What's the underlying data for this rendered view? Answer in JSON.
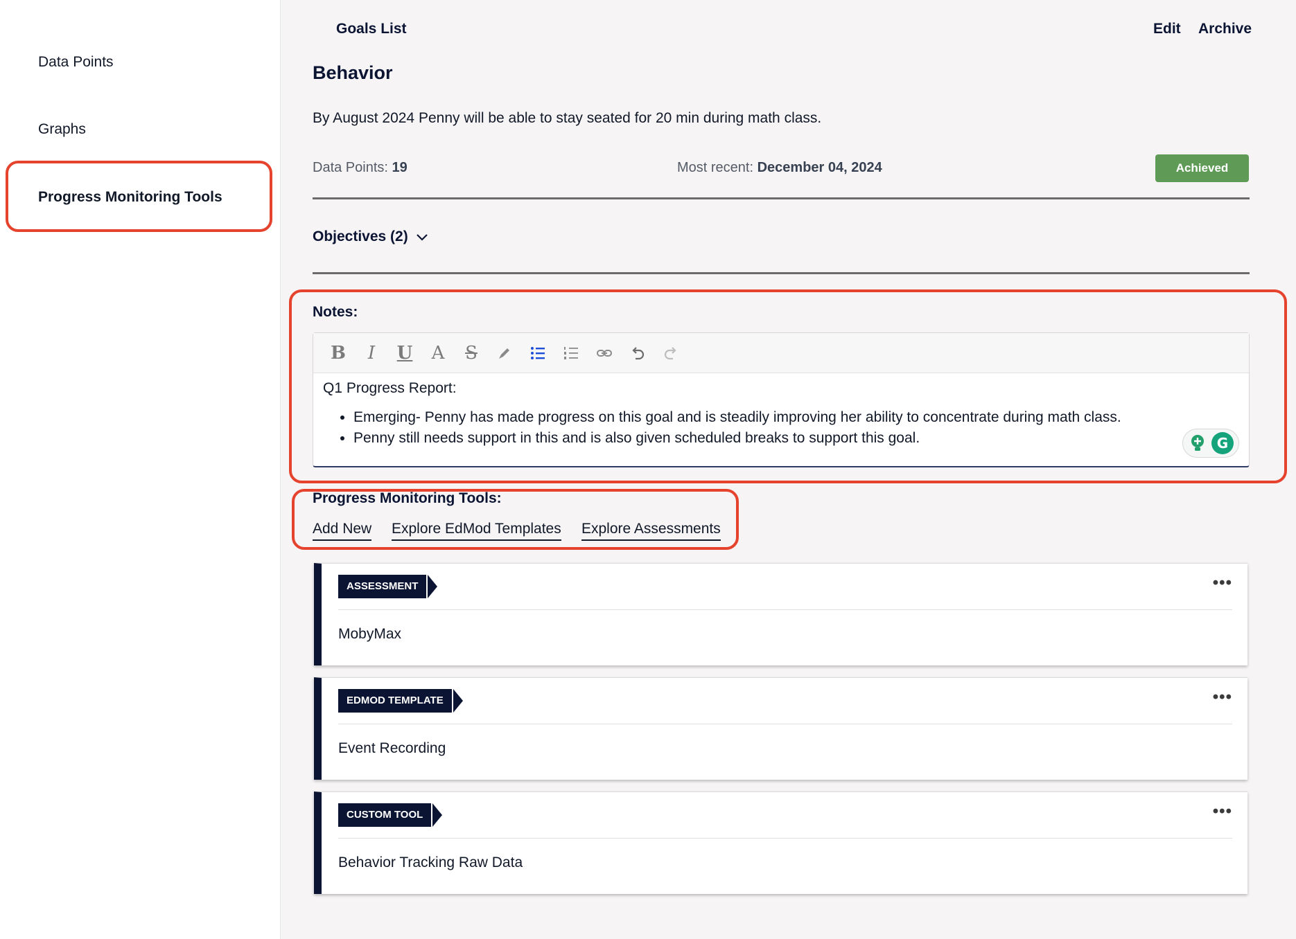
{
  "sidebar": {
    "items": [
      {
        "label": "Data Points"
      },
      {
        "label": "Graphs"
      },
      {
        "label": "Progress Monitoring Tools"
      }
    ]
  },
  "header": {
    "goals_list": "Goals List",
    "edit": "Edit",
    "archive": "Archive"
  },
  "goal": {
    "title": "Behavior",
    "description": "By August 2024 Penny will be able to stay seated for 20 min during math class.",
    "data_points_label": "Data Points:",
    "data_points_value": "19",
    "most_recent_label": "Most recent:",
    "most_recent_value": "December 04, 2024",
    "status": "Achieved",
    "status_color": "#5f9b57"
  },
  "objectives": {
    "label": "Objectives (2)"
  },
  "notes": {
    "label": "Notes:",
    "heading": "Q1 Progress Report:",
    "bullets": [
      "Emerging- Penny has made progress on this goal and is steadily improving her ability to concentrate during math class.",
      "Penny still needs support in this and is also given scheduled breaks to support this goal."
    ],
    "toolbar": [
      "bold-icon",
      "italic-icon",
      "underline-icon",
      "font-color-icon",
      "strikethrough-icon",
      "highlight-icon",
      "bullet-list-icon",
      "numbered-list-icon",
      "link-icon",
      "undo-icon",
      "redo-icon"
    ]
  },
  "pmt": {
    "label": "Progress Monitoring Tools:",
    "add_new": "Add New",
    "explore_templates": "Explore EdMod Templates",
    "explore_assessments": "Explore Assessments",
    "cards": [
      {
        "tag": "ASSESSMENT",
        "name": "MobyMax"
      },
      {
        "tag": "EDMOD TEMPLATE",
        "name": "Event Recording"
      },
      {
        "tag": "CUSTOM TOOL",
        "name": "Behavior Tracking Raw Data"
      }
    ]
  },
  "colors": {
    "accent_navy": "#0b1533",
    "highlight_red": "#e5432d",
    "active_list_blue": "#1d4ed8"
  }
}
